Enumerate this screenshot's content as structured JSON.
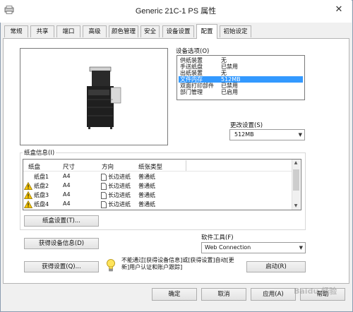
{
  "window": {
    "title": "Generic 21C-1 PS 属性",
    "close_glyph": "✕"
  },
  "tabs": [
    {
      "label": "常规",
      "active": false
    },
    {
      "label": "共享",
      "active": false
    },
    {
      "label": "端口",
      "active": false
    },
    {
      "label": "高级",
      "active": false
    },
    {
      "label": "颜色管理",
      "active": false
    },
    {
      "label": "安全",
      "active": false
    },
    {
      "label": "设备设置",
      "active": false
    },
    {
      "label": "配置",
      "active": true
    },
    {
      "label": "初始设定",
      "active": false
    }
  ],
  "device_options": {
    "label": "设备选项(O)",
    "items": [
      {
        "name": "供纸装置",
        "value": "无",
        "selected": false
      },
      {
        "name": "手送纸盘",
        "value": "已禁用",
        "selected": false
      },
      {
        "name": "出纸装置",
        "value": "无",
        "selected": false
      },
      {
        "name": "文件内存",
        "value": "512MB",
        "selected": true
      },
      {
        "name": "双面打印部件",
        "value": "已禁用",
        "selected": false
      },
      {
        "name": "部门管理",
        "value": "已启用",
        "selected": false
      }
    ],
    "change_label": "更改设置(S)",
    "change_value": "512MB"
  },
  "tray_info": {
    "label": "纸盒信息(I)",
    "headers": [
      "纸盘",
      "尺寸",
      "方向",
      "纸张类型"
    ],
    "rows": [
      {
        "tray": "纸盘1",
        "size": "A4",
        "orientation": "长边进纸",
        "type": "普通纸",
        "warning": false
      },
      {
        "tray": "纸盘2",
        "size": "A4",
        "orientation": "长边进纸",
        "type": "普通纸",
        "warning": true
      },
      {
        "tray": "纸盘3",
        "size": "A4",
        "orientation": "长边进纸",
        "type": "普通纸",
        "warning": true
      },
      {
        "tray": "纸盘4",
        "size": "A4",
        "orientation": "长边进纸",
        "type": "普通纸",
        "warning": true
      }
    ],
    "settings_button": "纸盒设置(T)..."
  },
  "buttons": {
    "get_device_info": "获得设备信息(D)",
    "get_settings": "获得设置(Q)...",
    "launch": "启动(R)",
    "ok": "确定",
    "cancel": "取消",
    "apply": "应用(A)",
    "help": "帮助"
  },
  "software_tools": {
    "label": "软件工具(F)",
    "value": "Web Connection"
  },
  "note": "不能通过[获得设备信息]或[获得设置]自动[更新]用户认证和账户跟踪]",
  "watermark": "Baidu 经验",
  "colors": {
    "selection": "#3399ff",
    "window_bg": "#f0f0f0",
    "panel_bg": "#ffffff",
    "warning": "#f5c400"
  }
}
